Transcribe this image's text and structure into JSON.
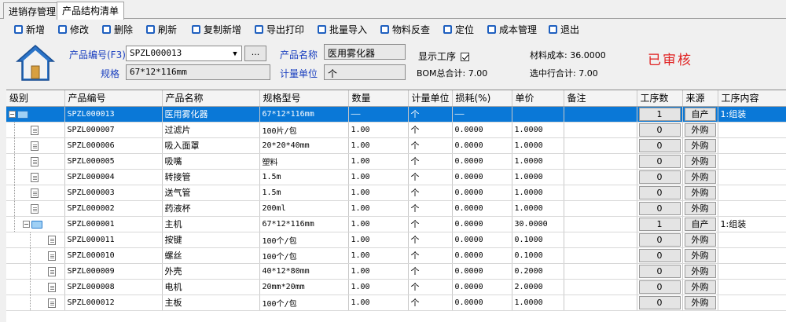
{
  "tabs": [
    {
      "label": "进销存管理"
    },
    {
      "label": "产品结构清单"
    }
  ],
  "toolbar": [
    {
      "label": "新增"
    },
    {
      "label": "修改"
    },
    {
      "label": "删除"
    },
    {
      "label": "刷新"
    },
    {
      "label": "复制新增"
    },
    {
      "label": "导出打印"
    },
    {
      "label": "批量导入"
    },
    {
      "label": "物料反查"
    },
    {
      "label": "定位"
    },
    {
      "label": "成本管理"
    },
    {
      "label": "退出"
    }
  ],
  "form": {
    "product_code_label": "产品编号(F3)",
    "product_code_value": "SPZL000013",
    "browse_button": "...",
    "spec_label": "规格",
    "spec_value": "67*12*116mm",
    "product_name_label": "产品名称",
    "product_name_value": "医用雾化器",
    "unit_label": "计量单位",
    "unit_value": "个",
    "show_process_label": "显示工序",
    "bom_total": "BOM总合计: 7.00",
    "material_cost": "材料成本: 36.0000",
    "selected_total": "选中行合计: 7.00",
    "status_stamp": "已审核"
  },
  "columns": [
    "级别",
    "产品编号",
    "产品名称",
    "规格型号",
    "数量",
    "计量单位",
    "损耗(%)",
    "单价",
    "备注",
    "工序数",
    "来源",
    "工序内容"
  ],
  "rows": [
    {
      "code": "SPZL000013",
      "name": "医用雾化器",
      "spec": "67*12*116mm",
      "qty": "——",
      "unit": "个",
      "loss": "——",
      "price": "",
      "note": "",
      "steps": "1",
      "source": "自产",
      "content": "1:组装"
    },
    {
      "code": "SPZL000007",
      "name": "过滤片",
      "spec": "100片/包",
      "qty": "1.00",
      "unit": "个",
      "loss": "0.0000",
      "price": "1.0000",
      "note": "",
      "steps": "0",
      "source": "外购",
      "content": ""
    },
    {
      "code": "SPZL000006",
      "name": "吸入面罩",
      "spec": "20*20*40mm",
      "qty": "1.00",
      "unit": "个",
      "loss": "0.0000",
      "price": "1.0000",
      "note": "",
      "steps": "0",
      "source": "外购",
      "content": ""
    },
    {
      "code": "SPZL000005",
      "name": "吸嘴",
      "spec": "塑料",
      "qty": "1.00",
      "unit": "个",
      "loss": "0.0000",
      "price": "1.0000",
      "note": "",
      "steps": "0",
      "source": "外购",
      "content": ""
    },
    {
      "code": "SPZL000004",
      "name": "转接管",
      "spec": "1.5m",
      "qty": "1.00",
      "unit": "个",
      "loss": "0.0000",
      "price": "1.0000",
      "note": "",
      "steps": "0",
      "source": "外购",
      "content": ""
    },
    {
      "code": "SPZL000003",
      "name": "送气管",
      "spec": "1.5m",
      "qty": "1.00",
      "unit": "个",
      "loss": "0.0000",
      "price": "1.0000",
      "note": "",
      "steps": "0",
      "source": "外购",
      "content": ""
    },
    {
      "code": "SPZL000002",
      "name": "药液杯",
      "spec": "200ml",
      "qty": "1.00",
      "unit": "个",
      "loss": "0.0000",
      "price": "1.0000",
      "note": "",
      "steps": "0",
      "source": "外购",
      "content": ""
    },
    {
      "code": "SPZL000001",
      "name": "主机",
      "spec": "67*12*116mm",
      "qty": "1.00",
      "unit": "个",
      "loss": "0.0000",
      "price": "30.0000",
      "note": "",
      "steps": "1",
      "source": "自产",
      "content": "1:组装"
    },
    {
      "code": "SPZL000011",
      "name": "按键",
      "spec": "100个/包",
      "qty": "1.00",
      "unit": "个",
      "loss": "0.0000",
      "price": "0.1000",
      "note": "",
      "steps": "0",
      "source": "外购",
      "content": ""
    },
    {
      "code": "SPZL000010",
      "name": "螺丝",
      "spec": "100个/包",
      "qty": "1.00",
      "unit": "个",
      "loss": "0.0000",
      "price": "0.1000",
      "note": "",
      "steps": "0",
      "source": "外购",
      "content": ""
    },
    {
      "code": "SPZL000009",
      "name": "外壳",
      "spec": "40*12*80mm",
      "qty": "1.00",
      "unit": "个",
      "loss": "0.0000",
      "price": "0.2000",
      "note": "",
      "steps": "0",
      "source": "外购",
      "content": ""
    },
    {
      "code": "SPZL000008",
      "name": "电机",
      "spec": "20mm*20mm",
      "qty": "1.00",
      "unit": "个",
      "loss": "0.0000",
      "price": "2.0000",
      "note": "",
      "steps": "0",
      "source": "外购",
      "content": ""
    },
    {
      "code": "SPZL000012",
      "name": "主板",
      "spec": "100个/包",
      "qty": "1.00",
      "unit": "个",
      "loss": "0.0000",
      "price": "1.0000",
      "note": "",
      "steps": "0",
      "source": "外购",
      "content": ""
    }
  ]
}
